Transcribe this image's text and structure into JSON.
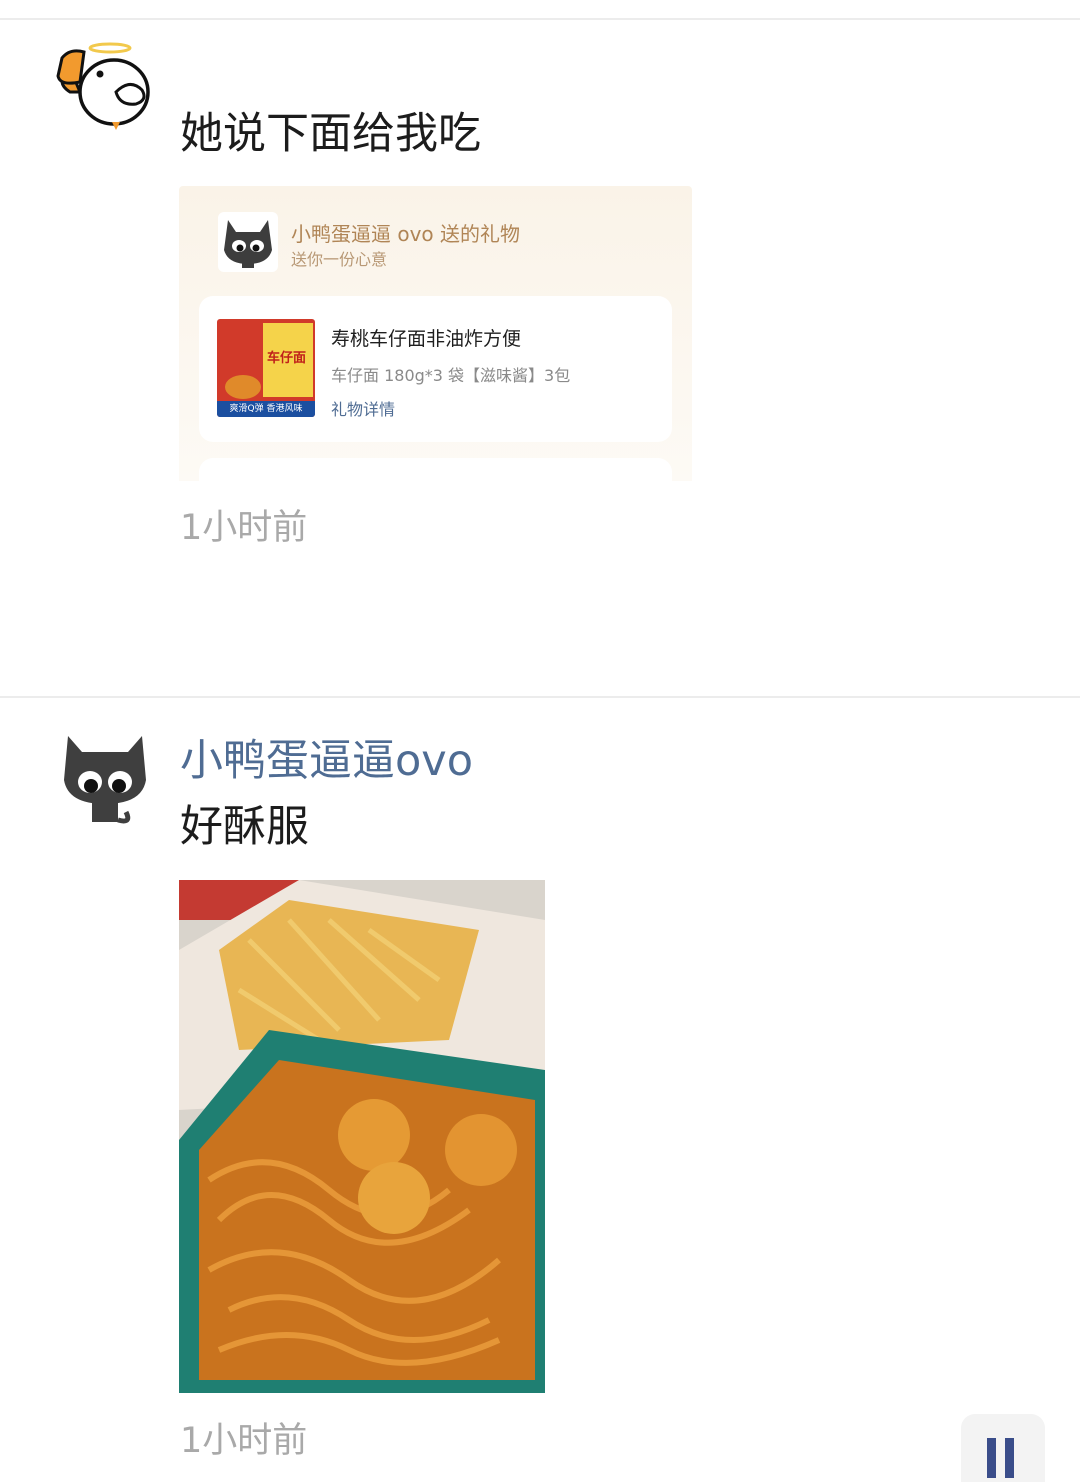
{
  "posts": [
    {
      "text": "她说下面给我吃",
      "time": "1小时前",
      "gift": {
        "sender_line": "小鸭蛋逼逼 ovo 送的礼物",
        "subtitle": "送你一份心意",
        "product_title": "寿桃车仔面非油炸方便",
        "product_spec": "车仔面 180g*3 袋【滋味酱】3包",
        "detail_link": "礼物详情",
        "package_text": "车仔面",
        "package_tagline": "爽滑Q弹 香港风味"
      }
    },
    {
      "username": "小鸭蛋逼逼ovo",
      "text": "好酥服",
      "time": "1小时前"
    }
  ],
  "icons": {
    "duck_avatar": "angel-duck-icon",
    "cat_avatar": "black-cat-icon",
    "float_button": "pause-icon"
  },
  "colors": {
    "username": "#4f6c93",
    "time": "#a9a9a9",
    "gift_sender": "#b08556",
    "link": "#4f6c93"
  }
}
